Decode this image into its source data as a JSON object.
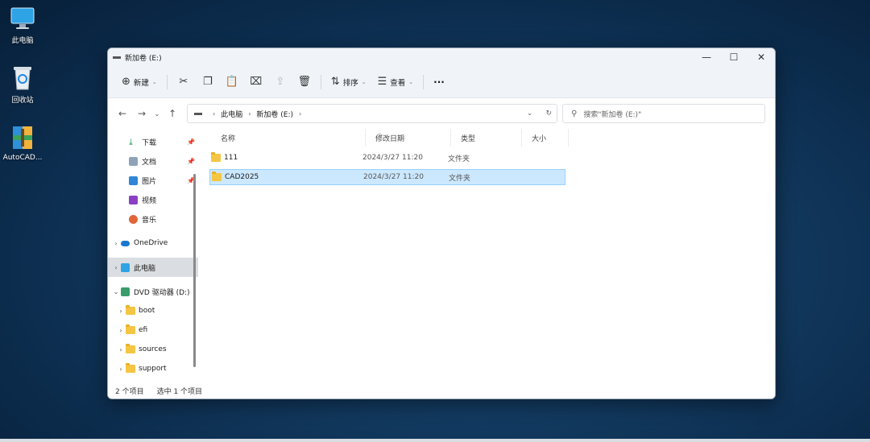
{
  "desktop": {
    "icons": [
      {
        "label": "此电脑",
        "icon": "monitor-icon"
      },
      {
        "label": "回收站",
        "icon": "recycle-bin-icon"
      },
      {
        "label": "AutoCAD...",
        "icon": "zip-archive-icon"
      }
    ]
  },
  "window": {
    "title": "新加卷 (E:)",
    "controls": {
      "minimize": "—",
      "maximize": "☐",
      "close": "✕"
    }
  },
  "toolbar": {
    "new_label": "新建",
    "sort_label": "排序",
    "view_label": "查看",
    "more_label": "···"
  },
  "address": {
    "crumbs": [
      "此电脑",
      "新加卷 (E:)"
    ],
    "search_placeholder": "搜索\"新加卷 (E:)\""
  },
  "nav": {
    "quick_access": [
      {
        "label": "下载",
        "icon": "download-icon",
        "pinned": true
      },
      {
        "label": "文档",
        "icon": "document-icon",
        "pinned": true
      },
      {
        "label": "图片",
        "icon": "picture-icon",
        "pinned": true
      },
      {
        "label": "视频",
        "icon": "video-icon",
        "pinned": false
      },
      {
        "label": "音乐",
        "icon": "music-icon",
        "pinned": false
      }
    ],
    "onedrive": "OneDrive",
    "this_pc": "此电脑",
    "dvd": "DVD 驱动器 (D:)",
    "dvd_children": [
      "boot",
      "efi",
      "sources",
      "support"
    ]
  },
  "columns": {
    "name": "名称",
    "date": "修改日期",
    "type": "类型",
    "size": "大小"
  },
  "files": [
    {
      "name": "111",
      "date": "2024/3/27 11:20",
      "type": "文件夹",
      "selected": false
    },
    {
      "name": "CAD2025",
      "date": "2024/3/27 11:20",
      "type": "文件夹",
      "selected": true
    }
  ],
  "status": {
    "count": "2 个项目",
    "selected": "选中 1 个项目"
  },
  "colors": {
    "accent": "#0067c0",
    "selection_bg": "#cce8ff",
    "selection_border": "#99d1ff",
    "folder": "#f5c643"
  }
}
